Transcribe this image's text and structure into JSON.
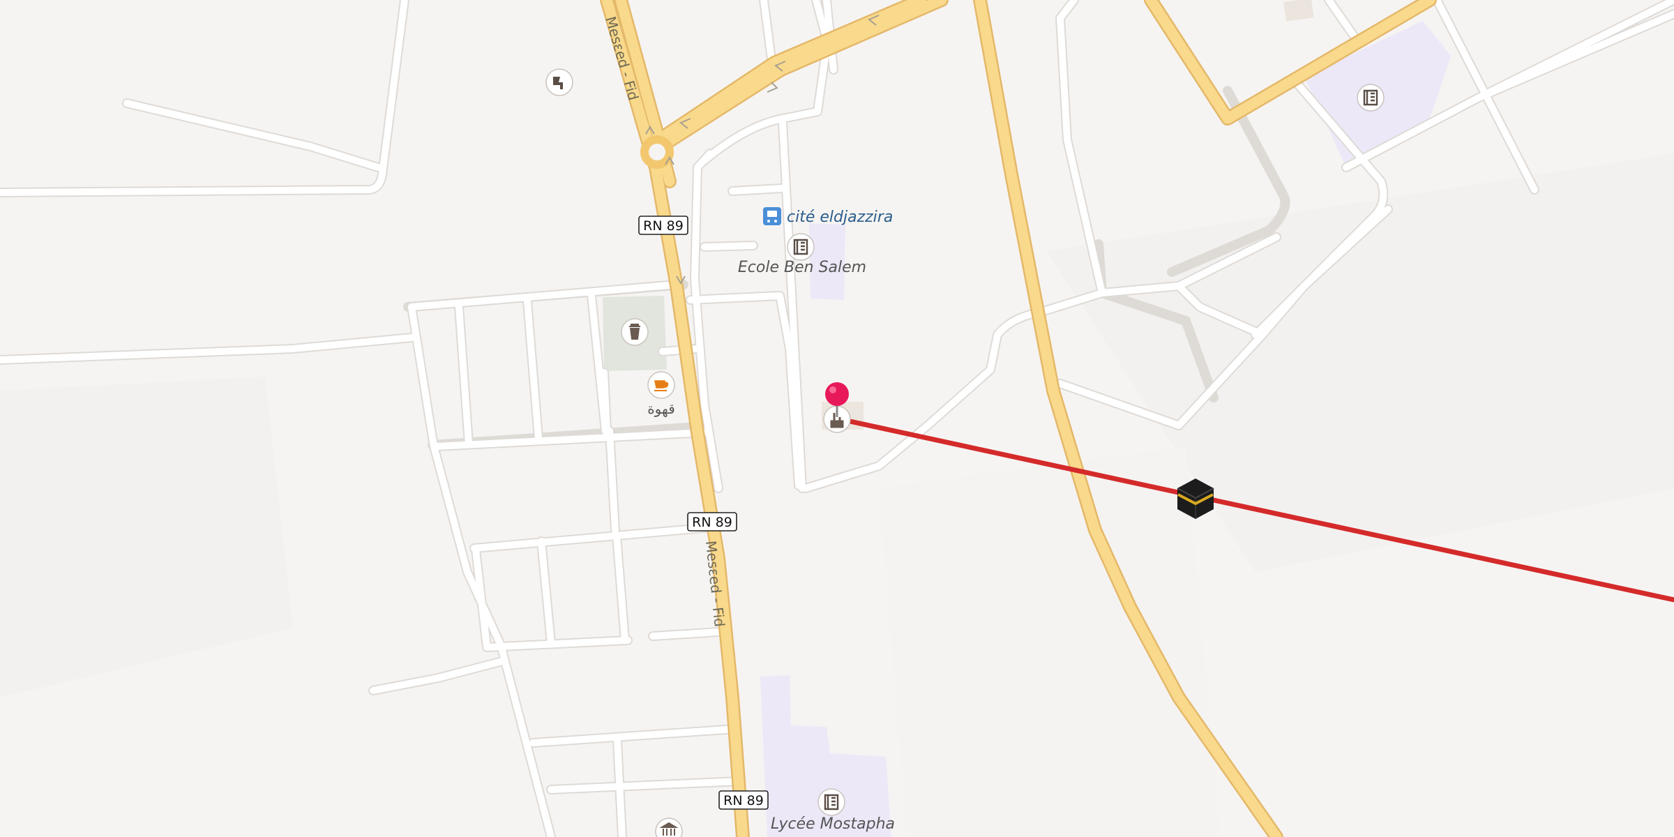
{
  "map": {
    "road_name": "Mesɛed - Fid",
    "route_shield": "RN 89",
    "places": {
      "bus_stop": "cité eldjazzira",
      "school_1": "Ecole Ben Salem",
      "school_2": "Lycée Mostapha",
      "cafe": "قهوة"
    },
    "icons": {
      "bus_stop": "bus-icon",
      "school": "school-icon",
      "cafe": "cafe-icon",
      "park": "trash-icon",
      "mosque": "mosque-icon",
      "kaaba": "kaaba-icon",
      "pin": "location-pin-icon",
      "monument": "monument-icon",
      "hairdresser": "hairdresser-icon"
    },
    "colors": {
      "background": "#f6f4f2",
      "major_road": "#f9d98b",
      "major_road_casing": "#e4b86a",
      "minor_road": "#ffffff",
      "minor_road_casing": "#dedad6",
      "school_area": "#ece8f8",
      "park_area": "#e3e6df",
      "qibla_line": "#d42a2a",
      "pin": "#e8195a",
      "bus_blue": "#4a8ed8",
      "label_blue": "#2b5d8c",
      "label_gray": "#555555"
    }
  }
}
